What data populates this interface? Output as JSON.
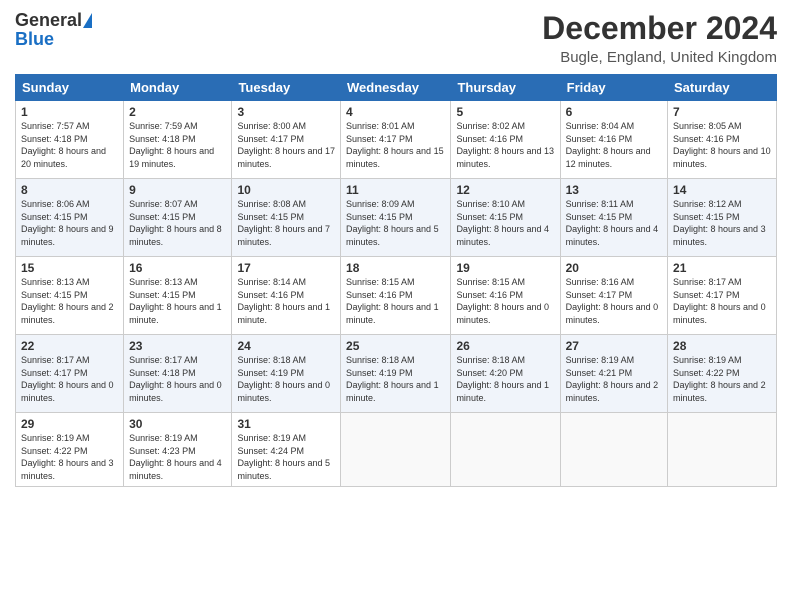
{
  "logo": {
    "general": "General",
    "blue": "Blue"
  },
  "title": "December 2024",
  "location": "Bugle, England, United Kingdom",
  "days_of_week": [
    "Sunday",
    "Monday",
    "Tuesday",
    "Wednesday",
    "Thursday",
    "Friday",
    "Saturday"
  ],
  "weeks": [
    [
      {
        "day": "1",
        "sunrise": "7:57 AM",
        "sunset": "4:18 PM",
        "daylight": "8 hours and 20 minutes"
      },
      {
        "day": "2",
        "sunrise": "7:59 AM",
        "sunset": "4:18 PM",
        "daylight": "8 hours and 19 minutes"
      },
      {
        "day": "3",
        "sunrise": "8:00 AM",
        "sunset": "4:17 PM",
        "daylight": "8 hours and 17 minutes"
      },
      {
        "day": "4",
        "sunrise": "8:01 AM",
        "sunset": "4:17 PM",
        "daylight": "8 hours and 15 minutes"
      },
      {
        "day": "5",
        "sunrise": "8:02 AM",
        "sunset": "4:16 PM",
        "daylight": "8 hours and 13 minutes"
      },
      {
        "day": "6",
        "sunrise": "8:04 AM",
        "sunset": "4:16 PM",
        "daylight": "8 hours and 12 minutes"
      },
      {
        "day": "7",
        "sunrise": "8:05 AM",
        "sunset": "4:16 PM",
        "daylight": "8 hours and 10 minutes"
      }
    ],
    [
      {
        "day": "8",
        "sunrise": "8:06 AM",
        "sunset": "4:15 PM",
        "daylight": "8 hours and 9 minutes"
      },
      {
        "day": "9",
        "sunrise": "8:07 AM",
        "sunset": "4:15 PM",
        "daylight": "8 hours and 8 minutes"
      },
      {
        "day": "10",
        "sunrise": "8:08 AM",
        "sunset": "4:15 PM",
        "daylight": "8 hours and 7 minutes"
      },
      {
        "day": "11",
        "sunrise": "8:09 AM",
        "sunset": "4:15 PM",
        "daylight": "8 hours and 5 minutes"
      },
      {
        "day": "12",
        "sunrise": "8:10 AM",
        "sunset": "4:15 PM",
        "daylight": "8 hours and 4 minutes"
      },
      {
        "day": "13",
        "sunrise": "8:11 AM",
        "sunset": "4:15 PM",
        "daylight": "8 hours and 4 minutes"
      },
      {
        "day": "14",
        "sunrise": "8:12 AM",
        "sunset": "4:15 PM",
        "daylight": "8 hours and 3 minutes"
      }
    ],
    [
      {
        "day": "15",
        "sunrise": "8:13 AM",
        "sunset": "4:15 PM",
        "daylight": "8 hours and 2 minutes"
      },
      {
        "day": "16",
        "sunrise": "8:13 AM",
        "sunset": "4:15 PM",
        "daylight": "8 hours and 1 minute"
      },
      {
        "day": "17",
        "sunrise": "8:14 AM",
        "sunset": "4:16 PM",
        "daylight": "8 hours and 1 minute"
      },
      {
        "day": "18",
        "sunrise": "8:15 AM",
        "sunset": "4:16 PM",
        "daylight": "8 hours and 1 minute"
      },
      {
        "day": "19",
        "sunrise": "8:15 AM",
        "sunset": "4:16 PM",
        "daylight": "8 hours and 0 minutes"
      },
      {
        "day": "20",
        "sunrise": "8:16 AM",
        "sunset": "4:17 PM",
        "daylight": "8 hours and 0 minutes"
      },
      {
        "day": "21",
        "sunrise": "8:17 AM",
        "sunset": "4:17 PM",
        "daylight": "8 hours and 0 minutes"
      }
    ],
    [
      {
        "day": "22",
        "sunrise": "8:17 AM",
        "sunset": "4:17 PM",
        "daylight": "8 hours and 0 minutes"
      },
      {
        "day": "23",
        "sunrise": "8:17 AM",
        "sunset": "4:18 PM",
        "daylight": "8 hours and 0 minutes"
      },
      {
        "day": "24",
        "sunrise": "8:18 AM",
        "sunset": "4:19 PM",
        "daylight": "8 hours and 0 minutes"
      },
      {
        "day": "25",
        "sunrise": "8:18 AM",
        "sunset": "4:19 PM",
        "daylight": "8 hours and 1 minute"
      },
      {
        "day": "26",
        "sunrise": "8:18 AM",
        "sunset": "4:20 PM",
        "daylight": "8 hours and 1 minute"
      },
      {
        "day": "27",
        "sunrise": "8:19 AM",
        "sunset": "4:21 PM",
        "daylight": "8 hours and 2 minutes"
      },
      {
        "day": "28",
        "sunrise": "8:19 AM",
        "sunset": "4:22 PM",
        "daylight": "8 hours and 2 minutes"
      }
    ],
    [
      {
        "day": "29",
        "sunrise": "8:19 AM",
        "sunset": "4:22 PM",
        "daylight": "8 hours and 3 minutes"
      },
      {
        "day": "30",
        "sunrise": "8:19 AM",
        "sunset": "4:23 PM",
        "daylight": "8 hours and 4 minutes"
      },
      {
        "day": "31",
        "sunrise": "8:19 AM",
        "sunset": "4:24 PM",
        "daylight": "8 hours and 5 minutes"
      },
      null,
      null,
      null,
      null
    ]
  ]
}
